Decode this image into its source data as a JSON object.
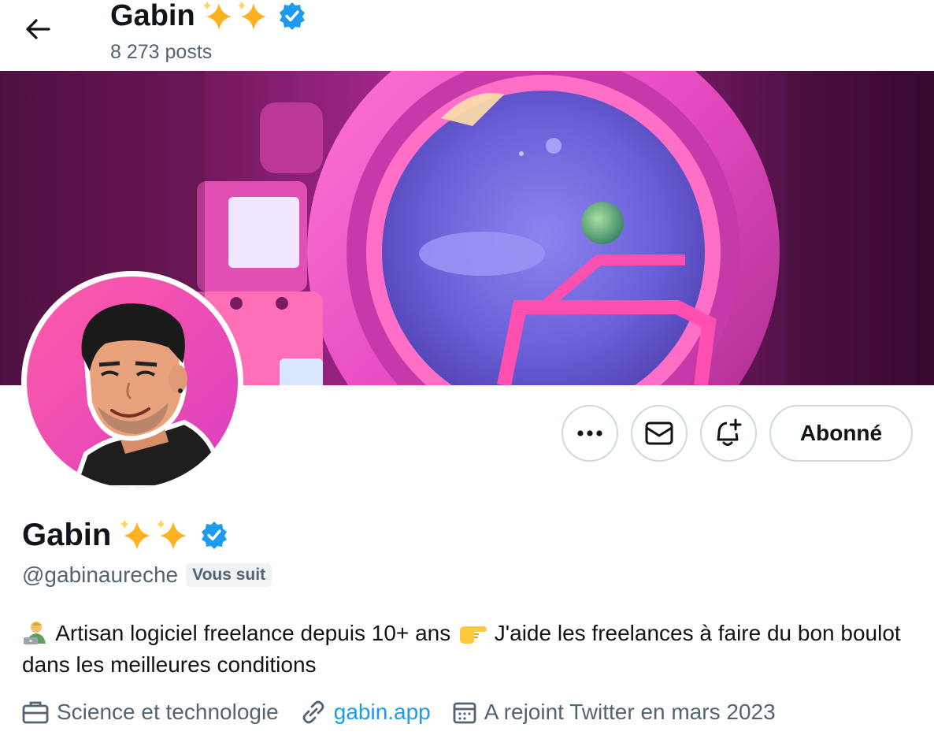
{
  "header": {
    "name": "Gabin",
    "posts_count": "8 273 posts"
  },
  "actions": {
    "follow_label": "Abonné"
  },
  "profile": {
    "name": "Gabin",
    "handle": "@gabinaureche",
    "follows_you": "Vous suit",
    "bio_part1": "Artisan logiciel freelance depuis 10+ ans",
    "bio_part2": "J'aide les freelances à faire du bon boulot dans les meilleures conditions",
    "category": "Science et technologie",
    "website": "gabin.app",
    "joined": "A rejoint Twitter en mars 2023"
  },
  "colors": {
    "verified": "#1d9bf0",
    "link": "#1d9bf0",
    "secondary_text": "#536471",
    "sparkle": "#ffb11f"
  },
  "icons": {
    "back": "arrow-left-icon",
    "more": "more-icon",
    "message": "envelope-icon",
    "notify": "bell-plus-icon",
    "verified": "verified-badge-icon",
    "category": "briefcase-icon",
    "website": "link-icon",
    "joined": "calendar-icon"
  }
}
